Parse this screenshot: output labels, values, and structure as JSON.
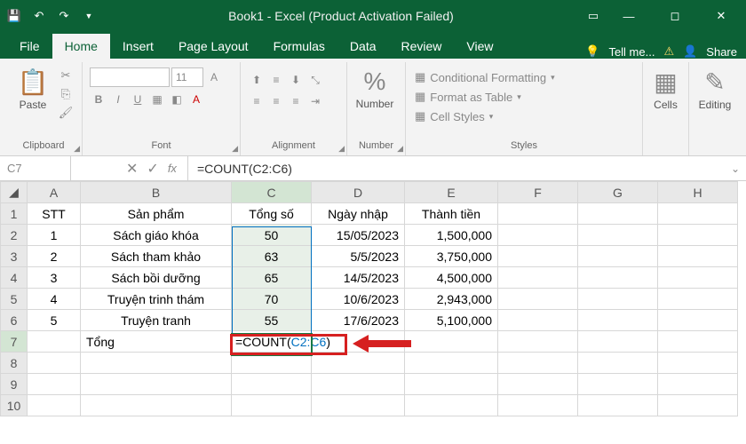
{
  "title": "Book1 - Excel (Product Activation Failed)",
  "tabs": {
    "file": "File",
    "home": "Home",
    "insert": "Insert",
    "pageLayout": "Page Layout",
    "formulas": "Formulas",
    "data": "Data",
    "review": "Review",
    "view": "View",
    "tellMe": "Tell me...",
    "share": "Share"
  },
  "ribbon": {
    "clipboard": {
      "label": "Clipboard",
      "paste": "Paste"
    },
    "font": {
      "label": "Font",
      "size": "11",
      "bold": "B",
      "italic": "I",
      "underline": "U"
    },
    "alignment": {
      "label": "Alignment"
    },
    "number": {
      "label": "Number",
      "btn": "Number",
      "pct": "%"
    },
    "styles": {
      "label": "Styles",
      "cond": "Conditional Formatting",
      "table": "Format as Table",
      "cell": "Cell Styles"
    },
    "cells": {
      "label": "Cells"
    },
    "editing": {
      "label": "Editing"
    }
  },
  "nameBox": "C7",
  "formula": "=COUNT(C2:C6)",
  "cellFormula": {
    "prefix": "=COUNT(",
    "ref": "C2:C6",
    "suffix": ")"
  },
  "cols": [
    "A",
    "B",
    "C",
    "D",
    "E",
    "F",
    "G",
    "H"
  ],
  "headers": {
    "A": "STT",
    "B": "Sản phẩm",
    "C": "Tổng số",
    "D": "Ngày nhập",
    "E": "Thành tiền"
  },
  "rows": [
    {
      "A": "1",
      "B": "Sách giáo khóa",
      "C": "50",
      "D": "15/05/2023",
      "E": "1,500,000"
    },
    {
      "A": "2",
      "B": "Sách tham khảo",
      "C": "63",
      "D": "5/5/2023",
      "E": "3,750,000"
    },
    {
      "A": "3",
      "B": "Sách bồi dưỡng",
      "C": "65",
      "D": "14/5/2023",
      "E": "4,500,000"
    },
    {
      "A": "4",
      "B": "Truyện trinh thám",
      "C": "70",
      "D": "10/6/2023",
      "E": "2,943,000"
    },
    {
      "A": "5",
      "B": "Truyện tranh",
      "C": "55",
      "D": "17/6/2023",
      "E": "5,100,000"
    }
  ],
  "totalLabel": "Tổng"
}
